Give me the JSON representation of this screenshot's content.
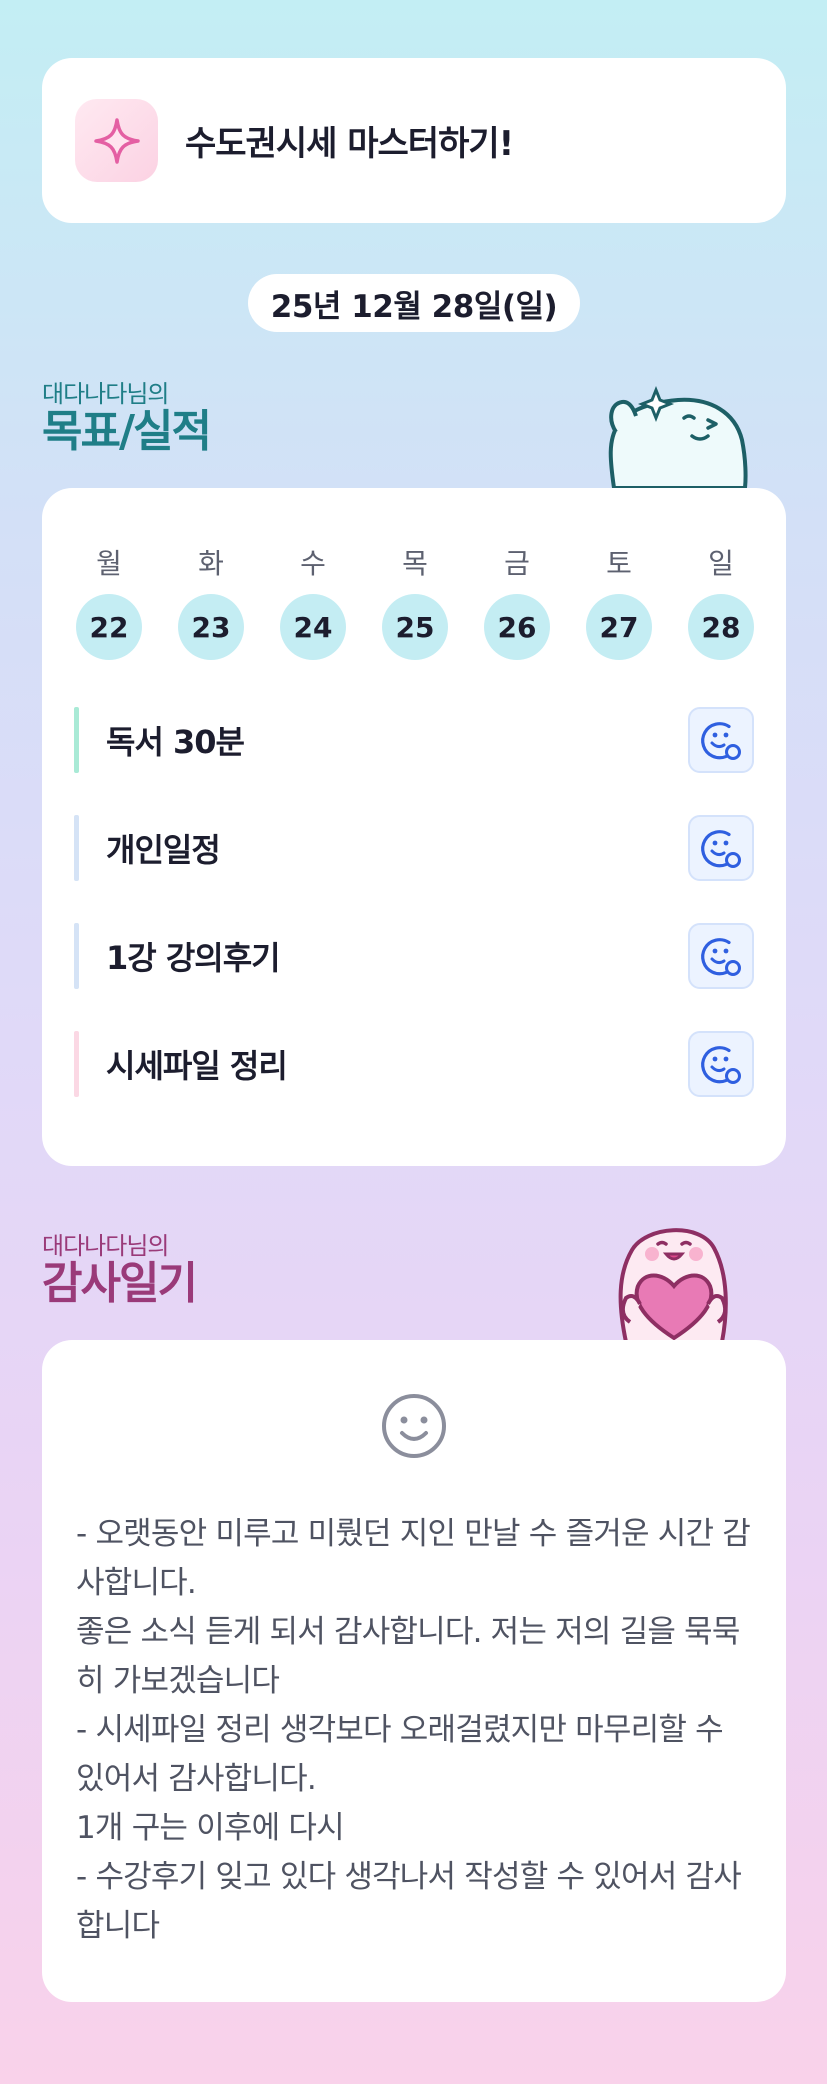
{
  "header": {
    "title": "수도권시세 마스터하기!",
    "icon": "sparkle-icon"
  },
  "date": "25년 12월 28일(일)",
  "goals_section": {
    "subtitle": "대다나다님의",
    "title": "목표/실적"
  },
  "week": [
    {
      "name": "월",
      "num": "22"
    },
    {
      "name": "화",
      "num": "23"
    },
    {
      "name": "수",
      "num": "24"
    },
    {
      "name": "목",
      "num": "25"
    },
    {
      "name": "금",
      "num": "26"
    },
    {
      "name": "토",
      "num": "27"
    },
    {
      "name": "일",
      "num": "28"
    }
  ],
  "goals": [
    {
      "label": "독서 30분",
      "color": "#a9ead6",
      "icon": "add-reaction-icon"
    },
    {
      "label": "개인일정",
      "color": "#d5e3f6",
      "icon": "add-reaction-icon"
    },
    {
      "label": "1강 강의후기",
      "color": "#d5e3f6",
      "icon": "add-reaction-icon"
    },
    {
      "label": "시세파일 정리",
      "color": "#fbd8e4",
      "icon": "add-reaction-icon"
    }
  ],
  "thanks_section": {
    "subtitle": "대다나다님의",
    "title": "감사일기"
  },
  "journal": {
    "icon": "smile-icon",
    "lines": [
      "- 오랫동안 미루고 미뤘던 지인 만날 수 즐거운 시간 감사합니다.",
      "좋은 소식 듣게 되서 감사합니다. 저는 저의 길을 묵묵히 가보겠습니다",
      "- 시세파일 정리 생각보다 오래걸렸지만 마무리할 수 있어서 감사합니다.",
      "1개 구는 이후에 다시",
      "- 수강후기 잊고 있다 생각나서 작성할 수 있어서 감사합니다"
    ]
  },
  "colors": {
    "goal_teal": "#1f7e87",
    "thanks_plum": "#9a3a79",
    "accent_blue": "#2f5fe0",
    "accent_pink": "#e45fa3"
  }
}
